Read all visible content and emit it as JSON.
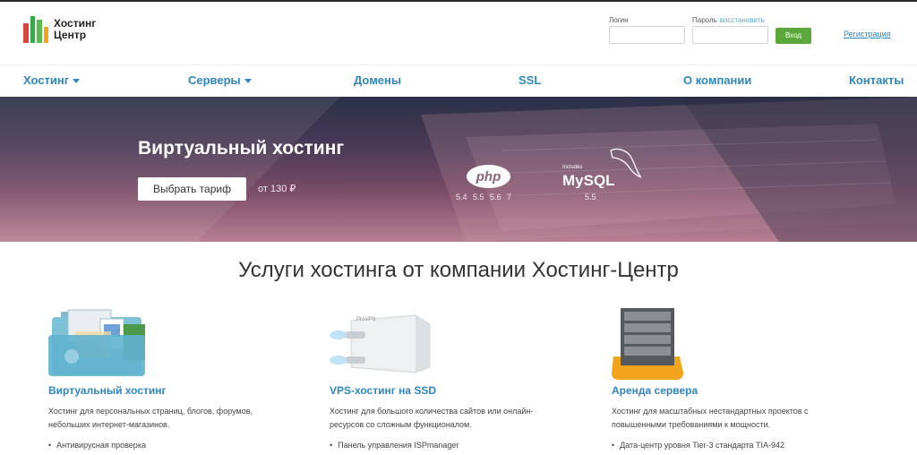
{
  "header": {
    "logo_line1": "Хостинг",
    "logo_line2": "Центр",
    "login_label": "Логин",
    "password_label": "Пароль",
    "restore_link": "восстановить",
    "login_button": "Вход",
    "register_link": "Регистрация"
  },
  "nav": {
    "items": [
      {
        "label": "Хостинг",
        "dropdown": true
      },
      {
        "label": "Серверы",
        "dropdown": true
      },
      {
        "label": "Домены",
        "dropdown": false
      },
      {
        "label": "SSL",
        "dropdown": false
      },
      {
        "label": "О компании",
        "dropdown": false
      },
      {
        "label": "Контакты",
        "dropdown": false
      }
    ]
  },
  "banner": {
    "title": "Виртуальный хостинг",
    "button": "Выбрать тариф",
    "price": "от 130 ₽",
    "php_logo": "php",
    "php_versions": "5.4 5.5 5.6 7",
    "mysql_includes": "Includes",
    "mysql_logo": "MySQL",
    "mysql_version": "5.5"
  },
  "services": {
    "title": "Услуги хостинга от компании Хостинг-Центр",
    "cards": [
      {
        "title": "Виртуальный хостинг",
        "description": "Хостинг для персональных страниц, блогов, форумов, небольших интернет-магазинов.",
        "bullet": "Антивирусная проверка",
        "icon": "folder-icon"
      },
      {
        "title": "VPS-хостинг на SSD",
        "description": "Хостинг для большого количества сайтов или онлайн-ресурсов со сложным функционалом.",
        "bullet": "Панель управления ISPmanager",
        "icon": "vps-box-icon",
        "image_text": "ProVPS"
      },
      {
        "title": "Аренда сервера",
        "description": "Хостинг для масштабных нестандартных проектов с повышенными требованиями к мощности.",
        "bullet": "Дата-центр уровня Tier-3 стандарта TIA-942",
        "icon": "server-rack-icon"
      }
    ]
  },
  "colors": {
    "link_blue": "#2f86c0",
    "button_green": "#5aa83a",
    "logo_green": "#3aa84a",
    "logo_red": "#d9443a",
    "logo_orange": "#f2a51c"
  }
}
